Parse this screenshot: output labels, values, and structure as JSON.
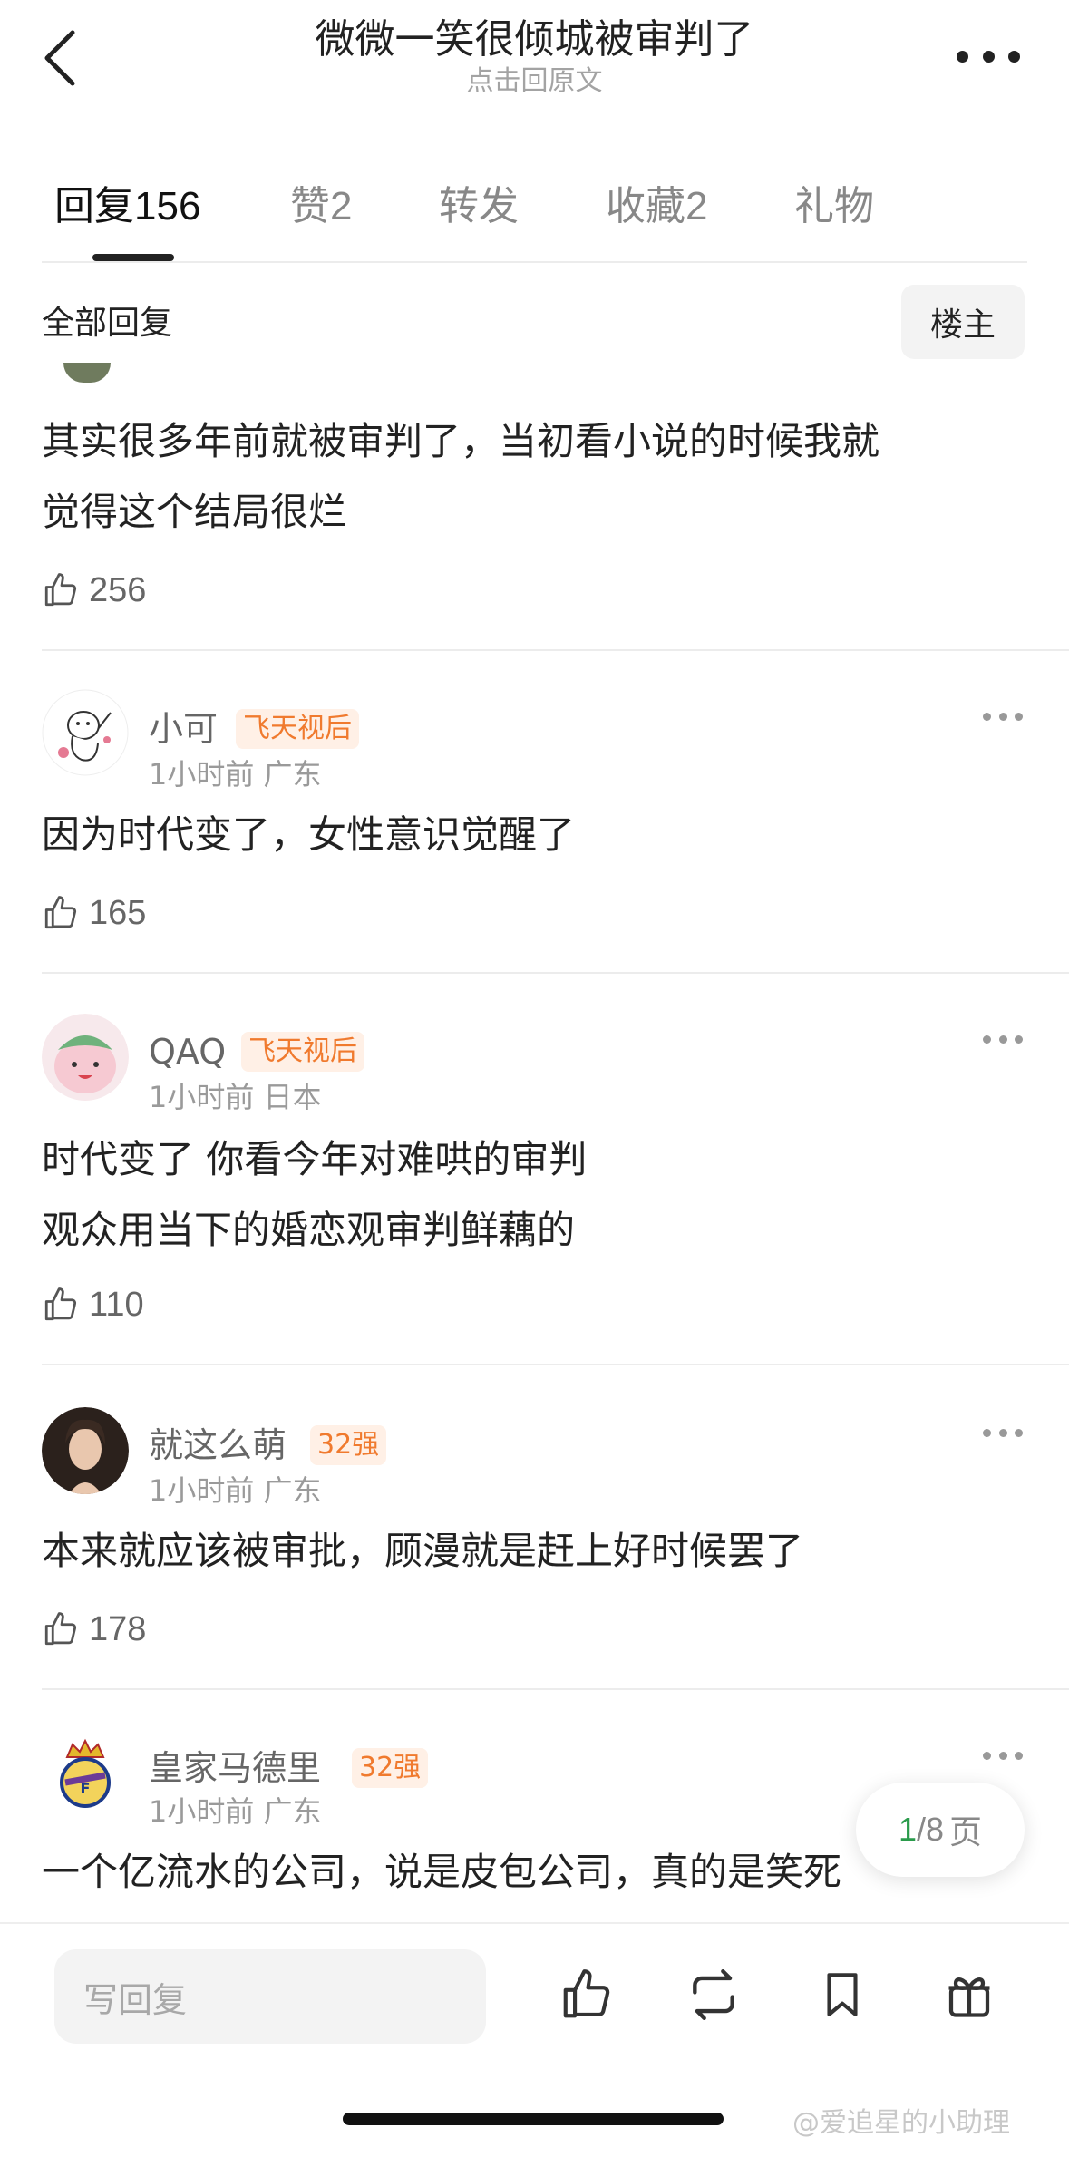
{
  "header": {
    "title": "微微一笑很倾城被审判了",
    "subtitle": "点击回原文"
  },
  "tabs": [
    {
      "label": "回复",
      "count": "156"
    },
    {
      "label": "赞",
      "count": "2"
    },
    {
      "label": "转发",
      "count": ""
    },
    {
      "label": "收藏",
      "count": "2"
    },
    {
      "label": "礼物",
      "count": ""
    }
  ],
  "filter": {
    "label": "全部回复",
    "owner_button": "楼主"
  },
  "comments": [
    {
      "text_lines": [
        "其实很多年前就被审判了，当初看小说的时候我就",
        "觉得这个结局很烂"
      ],
      "likes": "256"
    },
    {
      "username": "小可",
      "badge": "飞天视后",
      "time": "1小时前",
      "location": "广东",
      "text_lines": [
        "因为时代变了，女性意识觉醒了"
      ],
      "likes": "165"
    },
    {
      "username": "QAQ",
      "badge": "飞天视后",
      "time": "1小时前",
      "location": "日本",
      "text_lines": [
        "时代变了 你看今年对难哄的审判",
        "观众用当下的婚恋观审判鲜藕的"
      ],
      "likes": "110"
    },
    {
      "username": "就这么萌",
      "badge": "32强",
      "time": "1小时前",
      "location": "广东",
      "text_lines": [
        "本来就应该被审批，顾漫就是赶上好时候罢了"
      ],
      "likes": "178"
    },
    {
      "username": "皇家马德里",
      "badge": "32强",
      "time": "1小时前",
      "location": "广东",
      "text_lines": [
        "一个亿流水的公司，说是皮包公司，真的是笑死"
      ]
    }
  ],
  "pagination": {
    "current": "1",
    "total": "/8",
    "unit": "页"
  },
  "bottom_bar": {
    "reply_placeholder": "写回复"
  },
  "watermark": "@爱追星的小助理",
  "colors": {
    "badge_text": "#f07a2e",
    "badge_bg": "#fff0e6",
    "page_current": "#2a9b4b"
  }
}
